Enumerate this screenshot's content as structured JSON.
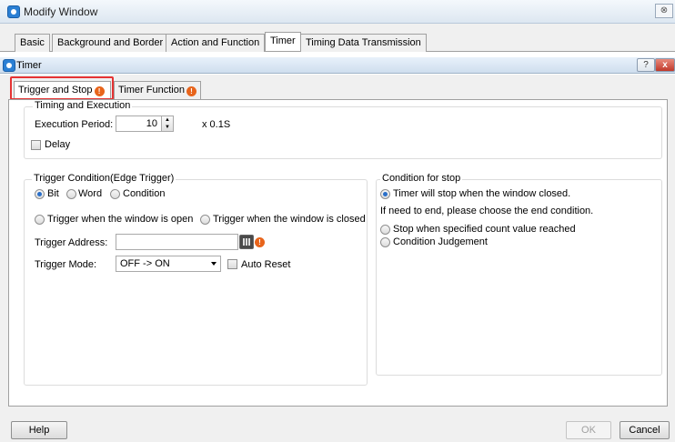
{
  "outer": {
    "title": "Modify Window",
    "close_glyph": "⊗",
    "tabs": [
      "Basic",
      "Background and Border",
      "Action and Function",
      "Timer",
      "Timing Data Transmission"
    ],
    "active_tab": "Timer"
  },
  "inner": {
    "title": "Timer",
    "help_glyph": "?",
    "close_glyph": "x",
    "tabs": [
      "Trigger and Stop",
      "Timer Function"
    ],
    "active_tab": "Trigger and Stop"
  },
  "timing": {
    "group_label": "Timing and Execution",
    "period_label": "Execution Period:",
    "period_value": "10",
    "unit": "x 0.1S",
    "delay_label": "Delay",
    "delay_checked": false
  },
  "trigger": {
    "group_label": "Trigger Condition(Edge Trigger)",
    "type_options": [
      "Bit",
      "Word",
      "Condition"
    ],
    "type_selected": "Bit",
    "window_open_label": "Trigger when the window is open",
    "window_closed_label": "Trigger when the window is closed",
    "address_label": "Trigger Address:",
    "address_value": "",
    "mode_label": "Trigger Mode:",
    "mode_value": "OFF -> ON",
    "auto_reset_label": "Auto Reset",
    "auto_reset_checked": false
  },
  "stop": {
    "group_label": "Condition for stop",
    "option_window_closed": "Timer will stop when the window closed.",
    "note": "If need to end, please choose the end condition.",
    "option_count": "Stop when specified count value reached",
    "option_condition": "Condition Judgement",
    "selected": "Timer will stop when the window closed."
  },
  "footer": {
    "help": "Help",
    "ok": "OK",
    "cancel": "Cancel"
  },
  "icons": {
    "app": "app-icon",
    "warning": "warning-icon",
    "calculator": "calculator-icon",
    "spin": "spin-arrows-icon",
    "dropdown": "chevron-down-icon"
  },
  "colors": {
    "highlight": "#e53333",
    "warning": "#e8641b",
    "radio_dot": "#2a6fc9"
  }
}
